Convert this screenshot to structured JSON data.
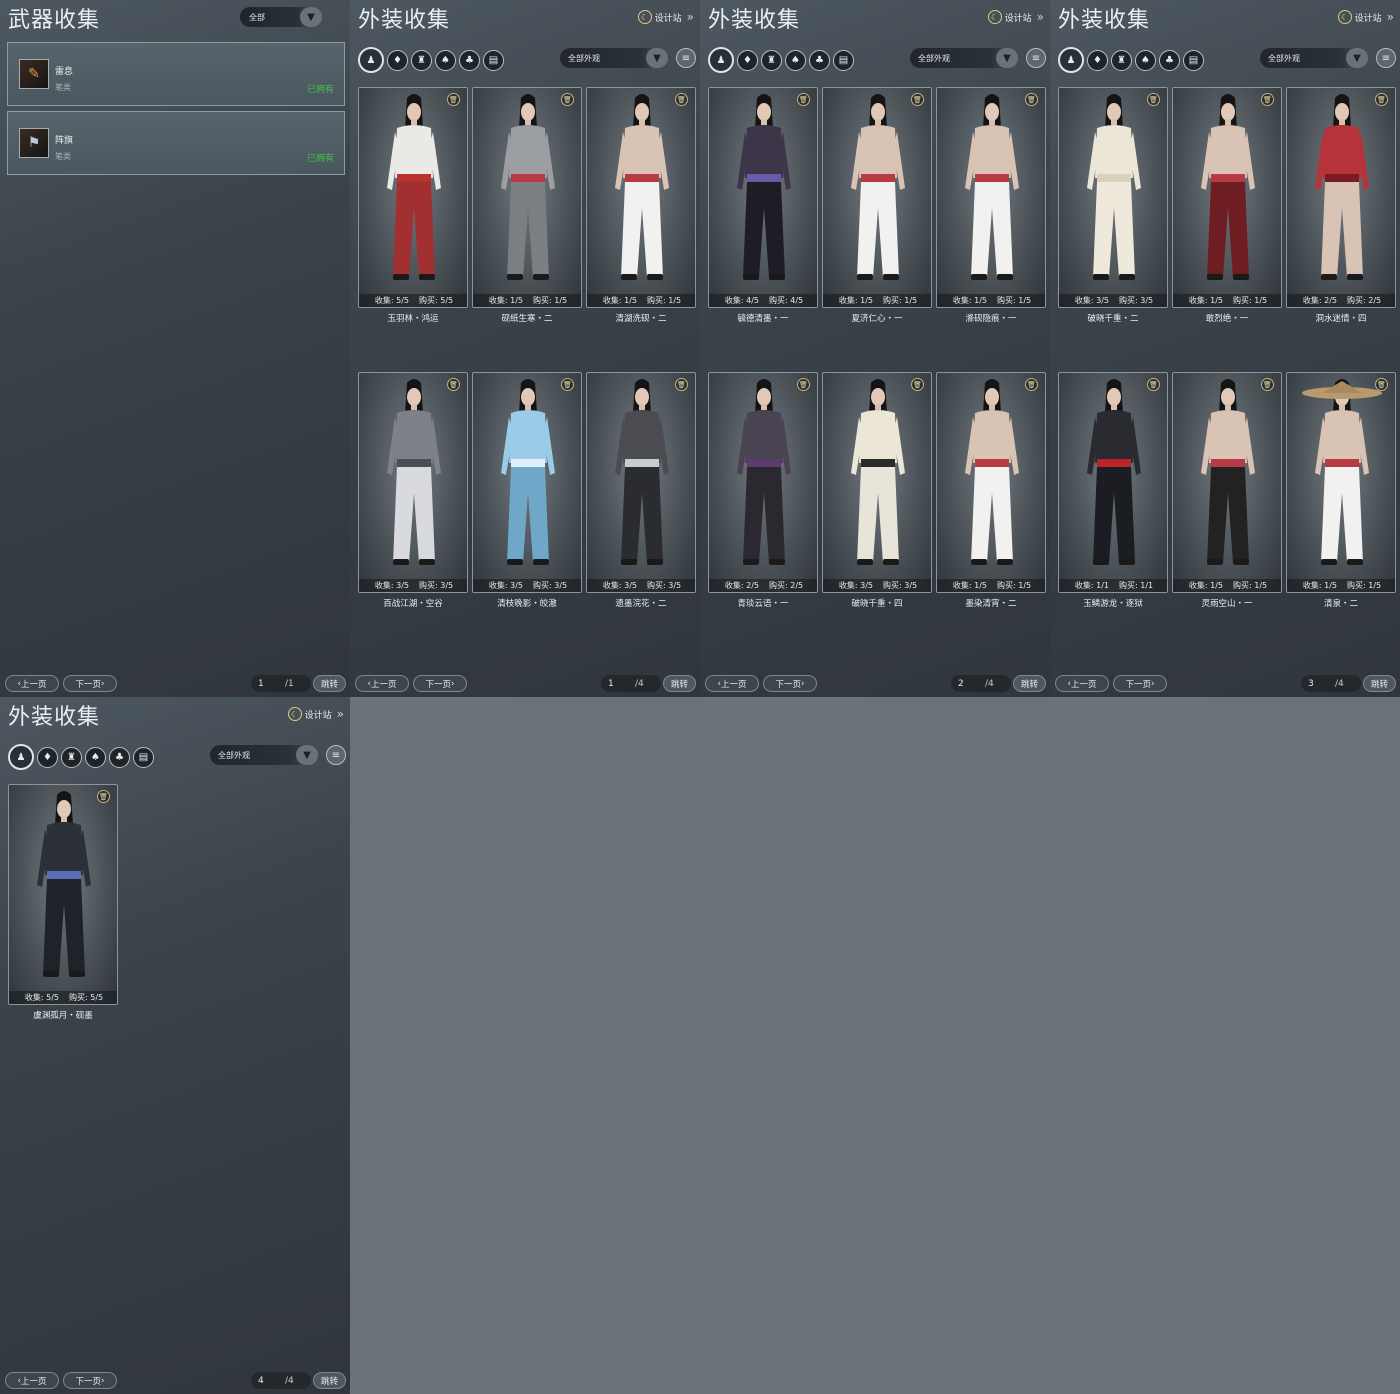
{
  "weapon_panel": {
    "title": "武器收集",
    "filter_value": "全部",
    "items": [
      {
        "name": "雷息",
        "type": "笔类",
        "status": "已拥有",
        "icon": "brush-weapon-icon"
      },
      {
        "name": "阵旗",
        "type": "笔类",
        "status": "已拥有",
        "icon": "flag-weapon-icon"
      }
    ],
    "prev_label": "上一页",
    "next_label": "下一页",
    "page_current": "1",
    "page_total": "/1",
    "jump_label": "跳转"
  },
  "outfit_common": {
    "title": "外装收集",
    "design_label": "设计站",
    "filter_value": "全部外观",
    "prev_label": "上一页",
    "next_label": "下一页",
    "jump_label": "跳转",
    "collect_prefix": "收集:",
    "buy_prefix": "购买:"
  },
  "outfit_pages": [
    {
      "page_current": "1",
      "page_total": "/4",
      "cards": [
        {
          "name": "玉羽林・鸿运",
          "collect": "5/5",
          "buy": "5/5",
          "palette": "white-red"
        },
        {
          "name": "砚纸生寒・二",
          "collect": "1/5",
          "buy": "1/5",
          "palette": "grey-skirt"
        },
        {
          "name": "清湖洗砚・二",
          "collect": "1/5",
          "buy": "1/5",
          "palette": "white-pants"
        },
        {
          "name": "百战江湖・空谷",
          "collect": "3/5",
          "buy": "3/5",
          "palette": "grey-robe"
        },
        {
          "name": "清枝晚影・皎澈",
          "collect": "3/5",
          "buy": "3/5",
          "palette": "light-blue"
        },
        {
          "name": "遗墨浣花・二",
          "collect": "3/5",
          "buy": "3/5",
          "palette": "black-silver"
        }
      ]
    },
    {
      "page_current": "2",
      "page_total": "/4",
      "cards": [
        {
          "name": "毓德清墨・一",
          "collect": "4/5",
          "buy": "4/5",
          "palette": "purple-black"
        },
        {
          "name": "夏济仁心・一",
          "collect": "1/5",
          "buy": "1/5",
          "palette": "white-pants"
        },
        {
          "name": "滌砚隐痕・一",
          "collect": "1/5",
          "buy": "1/5",
          "palette": "white-pants"
        },
        {
          "name": "青琰云语・一",
          "collect": "2/5",
          "buy": "2/5",
          "palette": "dark-purple"
        },
        {
          "name": "破晓千重・四",
          "collect": "3/5",
          "buy": "3/5",
          "palette": "white-black"
        },
        {
          "name": "墨染清宵・二",
          "collect": "1/5",
          "buy": "1/5",
          "palette": "white-pants"
        }
      ]
    },
    {
      "page_current": "3",
      "page_total": "/4",
      "cards": [
        {
          "name": "破晓千重・二",
          "collect": "3/5",
          "buy": "3/5",
          "palette": "cream-robe"
        },
        {
          "name": "敢烈绝・一",
          "collect": "1/5",
          "buy": "1/5",
          "palette": "red-pants"
        },
        {
          "name": "洞水迷情・四",
          "collect": "2/5",
          "buy": "2/5",
          "palette": "red-robe"
        },
        {
          "name": "玉鳞游龙・逐狱",
          "collect": "1/1",
          "buy": "1/1",
          "palette": "black-red"
        },
        {
          "name": "灵雨空山・一",
          "collect": "1/5",
          "buy": "1/5",
          "palette": "black-pants"
        },
        {
          "name": "清泉・二",
          "collect": "1/5",
          "buy": "1/5",
          "palette": "straw-hat"
        }
      ]
    },
    {
      "page_current": "4",
      "page_total": "/4",
      "cards": [
        {
          "name": "虞渊孤月・砚墨",
          "collect": "5/5",
          "buy": "5/5",
          "palette": "dark-blue"
        }
      ]
    }
  ],
  "category_icons": [
    "all-outfit-icon",
    "top-icon",
    "waist-icon",
    "bottom-icon",
    "boots-icon",
    "accessory-icon"
  ],
  "colors": {
    "owned_green": "#3fbe52",
    "panel_bg": "#3c444b",
    "page_bg": "#6b7279"
  }
}
